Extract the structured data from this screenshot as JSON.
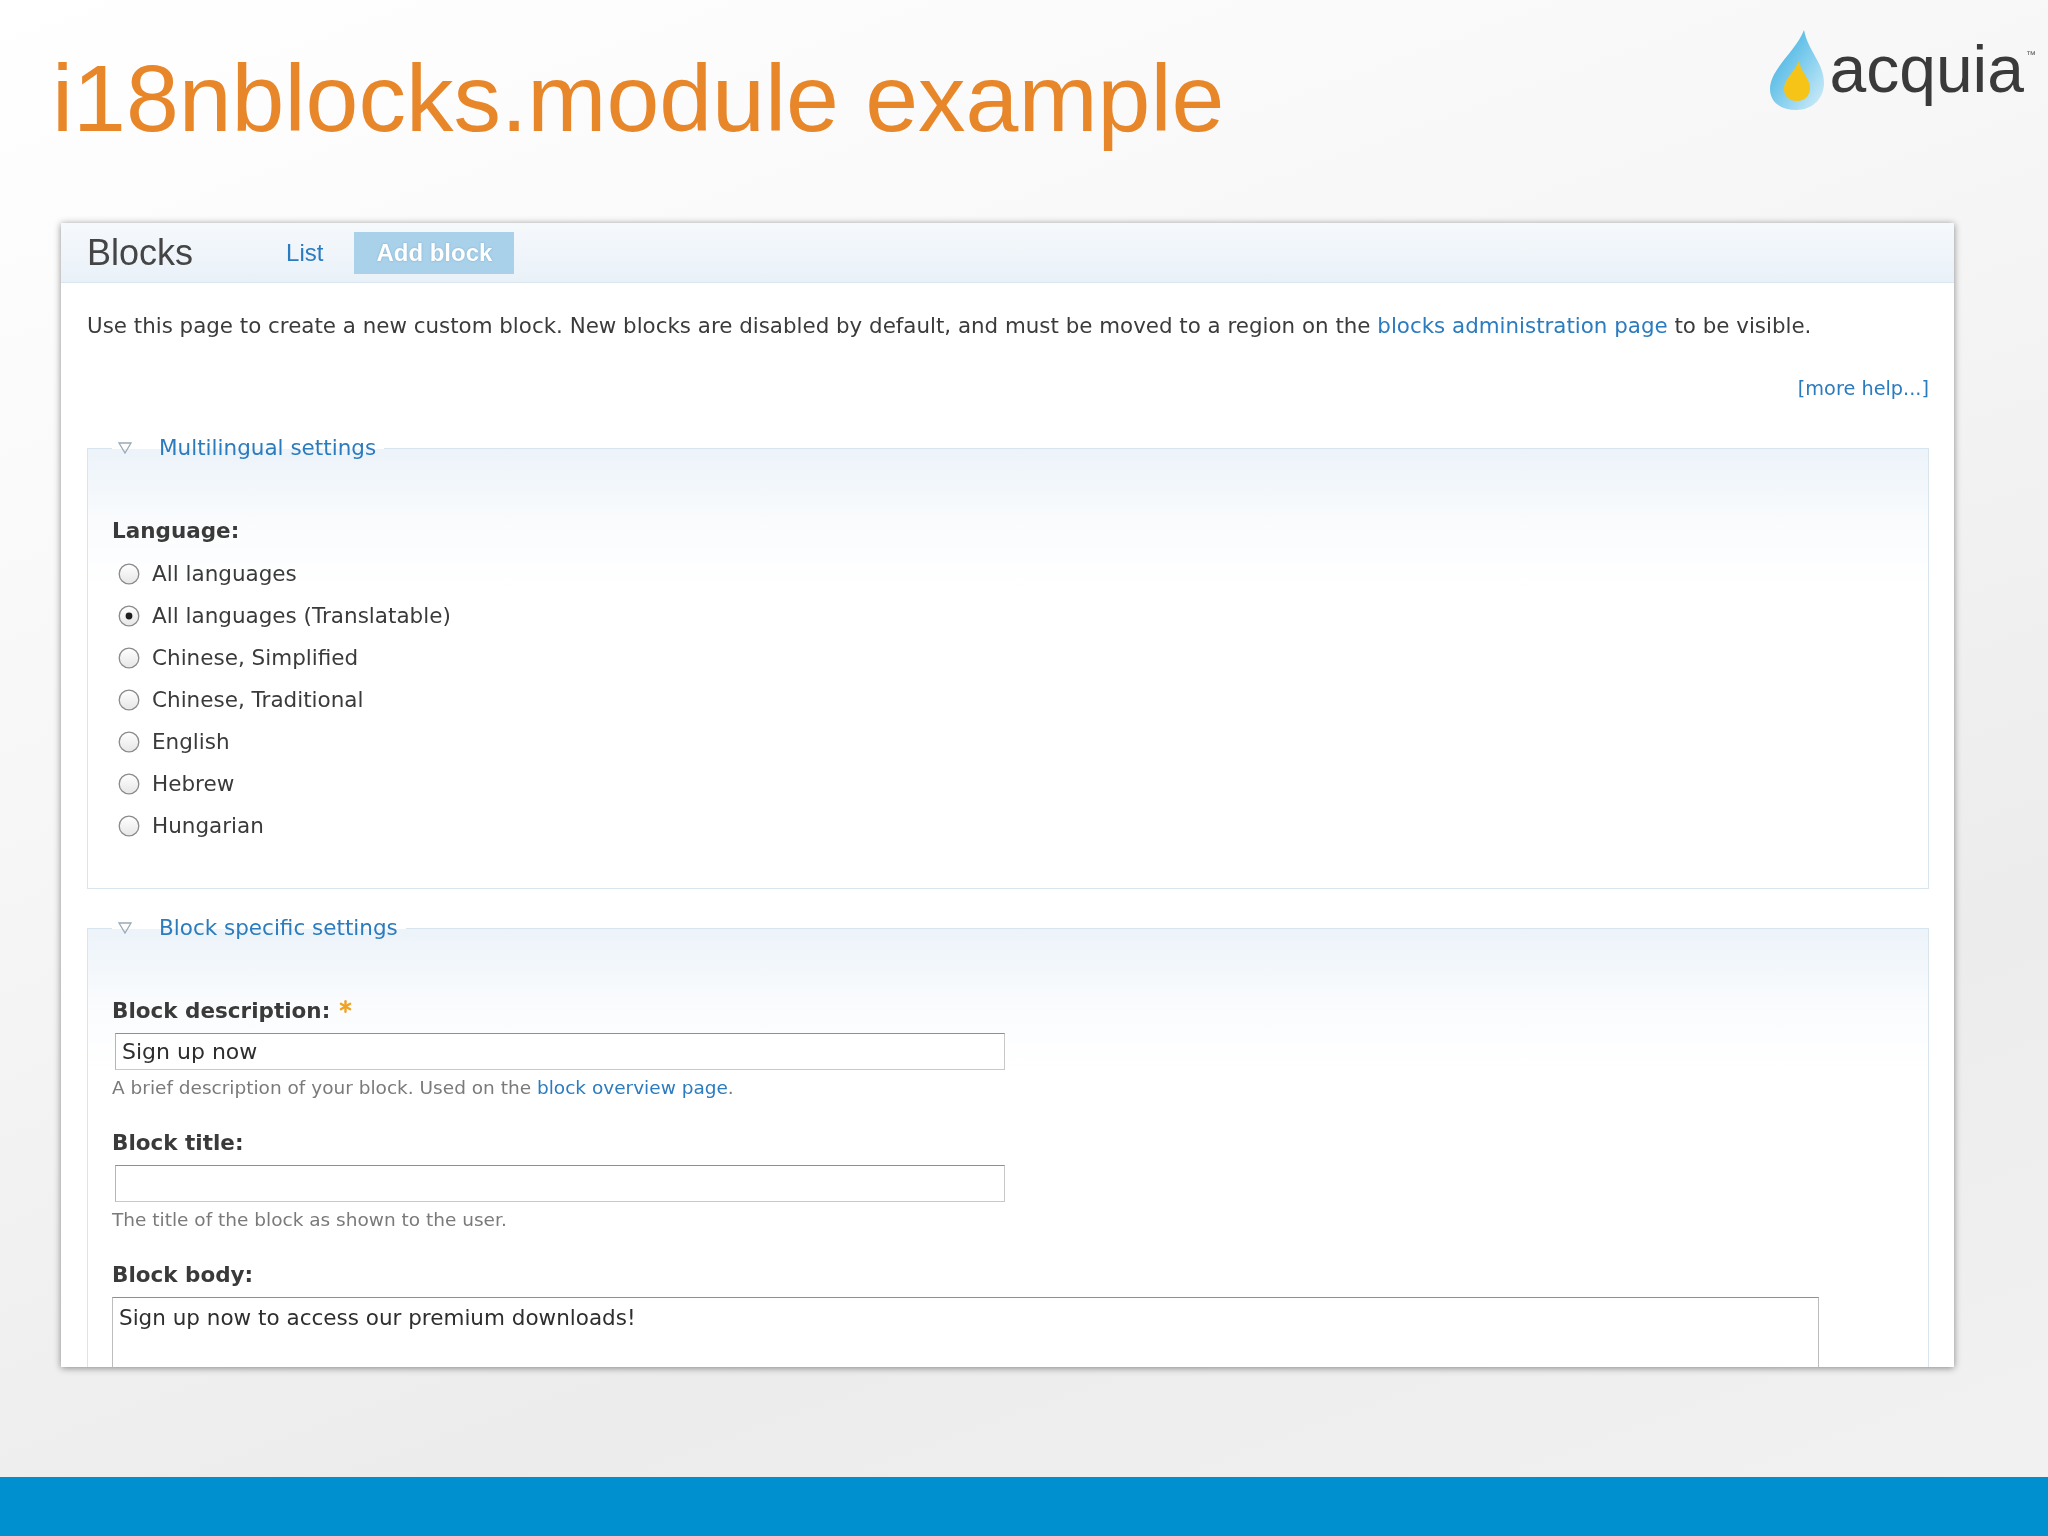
{
  "slide": {
    "title": "i18nblocks.module example"
  },
  "logo": {
    "text": "acquia",
    "mark": "™"
  },
  "page": {
    "title": "Blocks",
    "tabs": [
      {
        "label": "List",
        "selected": false
      },
      {
        "label": "Add block",
        "selected": true
      }
    ]
  },
  "intro": {
    "before": "Use this page to create a new custom block. New blocks are disabled by default, and must be moved to a region on the ",
    "link": "blocks administration page",
    "after": " to be visible."
  },
  "more_help": "[more help...]",
  "fieldsets": [
    {
      "legend": "Multilingual settings",
      "expanded": true,
      "fields": [
        {
          "kind": "radios",
          "label": "Language:",
          "options": [
            {
              "label": "All languages",
              "selected": false
            },
            {
              "label": "All languages (Translatable)",
              "selected": true
            },
            {
              "label": "Chinese, Simplified",
              "selected": false
            },
            {
              "label": "Chinese, Traditional",
              "selected": false
            },
            {
              "label": "English",
              "selected": false
            },
            {
              "label": "Hebrew",
              "selected": false
            },
            {
              "label": "Hungarian",
              "selected": false
            }
          ]
        }
      ]
    },
    {
      "legend": "Block specific settings",
      "expanded": true,
      "fields": [
        {
          "kind": "text",
          "label": "Block description:",
          "required": true,
          "value": "Sign up now",
          "help": {
            "before": "A brief description of your block. Used on the ",
            "link": "block overview page",
            "after": "."
          }
        },
        {
          "kind": "text",
          "label": "Block title:",
          "help": {
            "before": "The title of the block as shown to the user."
          }
        },
        {
          "kind": "textarea",
          "label": "Block body:",
          "value": "Sign up now to access our premium downloads!"
        }
      ]
    }
  ]
}
